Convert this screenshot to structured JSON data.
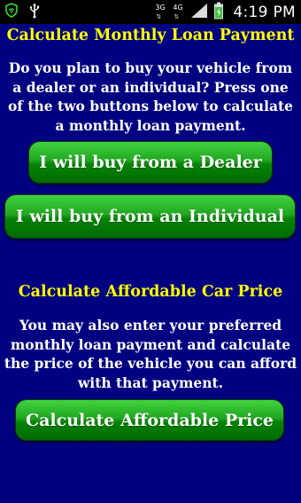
{
  "status_bar": {
    "network_1": "3G",
    "network_2": "4G",
    "time": "4:19 PM",
    "icons": [
      "shield-icon",
      "usb-icon",
      "signal-icon",
      "battery-icon"
    ]
  },
  "loan_section": {
    "title": "Calculate Monthly Loan Payment",
    "description": "Do you plan to buy your vehicle from a dealer or an individual? Press one of the two buttons below to calculate a monthly loan payment.",
    "dealer_button": "I will buy from a Dealer",
    "individual_button": "I will buy from an Individual"
  },
  "price_section": {
    "title": "Calculate Affordable Car Price",
    "description": "You may also enter your preferred monthly loan payment and calculate the price of the vehicle you can afford with that payment.",
    "button": "Calculate Affordable Price"
  },
  "colors": {
    "background": "#000080",
    "heading": "#ffff00",
    "text": "#ffffff",
    "button": "#1a9a1a"
  }
}
